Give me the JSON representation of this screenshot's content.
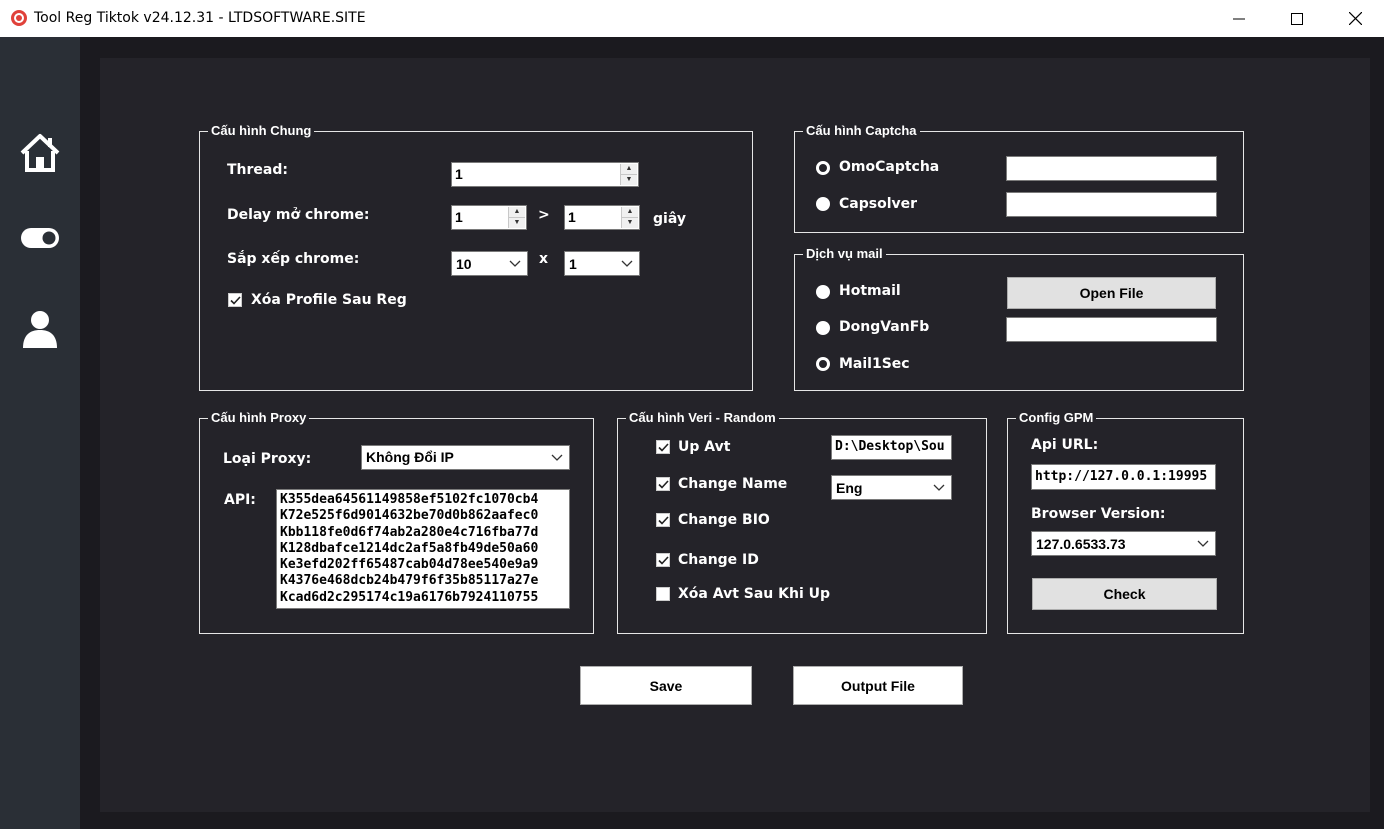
{
  "window": {
    "title": "Tool Reg Tiktok v24.12.31 - LTDSOFTWARE.SITE",
    "controls": {
      "minimize": "─",
      "maximize": "☐",
      "close": "✕"
    }
  },
  "sidebar": {
    "items": [
      "home-icon",
      "toggle-icon",
      "user-icon"
    ]
  },
  "general": {
    "title": "Cấu hình Chung",
    "thread_label": "Thread:",
    "thread_value": "1",
    "delay_label": "Delay mở chrome:",
    "delay_min": "1",
    "delay_sep": ">",
    "delay_max": "1",
    "delay_unit": "giây",
    "arrange_label": "Sắp xếp chrome:",
    "arrange_cols": "10",
    "arrange_sep": "x",
    "arrange_rows": "1",
    "delete_profile_label": "Xóa Profile Sau Reg",
    "delete_profile_checked": true
  },
  "captcha": {
    "title": "Cấu hình Captcha",
    "options": [
      {
        "label": "OmoCaptcha",
        "selected": true,
        "key": ""
      },
      {
        "label": "Capsolver",
        "selected": false,
        "key": ""
      }
    ]
  },
  "mail": {
    "title": "Dịch vụ mail",
    "hotmail_label": "Hotmail",
    "open_file_label": "Open File",
    "dongvan_label": "DongVanFb",
    "dongvan_value": "",
    "mail1sec_label": "Mail1Sec",
    "selected": "Mail1Sec"
  },
  "proxy": {
    "title": "Cấu hình Proxy",
    "type_label": "Loại Proxy:",
    "type_value": "Không Đổi IP",
    "api_label": "API:",
    "api_keys": [
      "K355dea64561149858ef5102fc1070cb4",
      "K72e525f6d9014632be70d0b862aafec0",
      "Kbb118fe0d6f74ab2a280e4c716fba77d",
      "K128dbafce1214dc2af5a8fb49de50a60",
      "Ke3efd202ff65487cab04d78ee540e9a9",
      "K4376e468dcb24b479f6f35b85117a27e",
      "Kcad6d2c295174c19a6176b7924110755"
    ]
  },
  "veri": {
    "title": "Cấu hình Veri - Random",
    "up_avt_label": "Up Avt",
    "avt_path": "D:\\Desktop\\Sou",
    "change_name_label": "Change Name",
    "name_lang": "Eng",
    "change_bio_label": "Change BIO",
    "change_id_label": "Change ID",
    "delete_avt_label": "Xóa Avt Sau Khi Up",
    "checks": {
      "up_avt": true,
      "change_name": true,
      "change_bio": true,
      "change_id": true,
      "delete_avt": false
    }
  },
  "gpm": {
    "title": "Config GPM",
    "api_url_label": "Api URL:",
    "api_url_value": "http://127.0.0.1:19995",
    "browser_label": "Browser Version:",
    "browser_value": "127.0.6533.73",
    "check_label": "Check"
  },
  "actions": {
    "save_label": "Save",
    "output_label": "Output File"
  },
  "colors": {
    "background": "#1b1a1f",
    "panel": "#242329",
    "sidebar": "#2a2f36",
    "text": "#ffffff"
  }
}
